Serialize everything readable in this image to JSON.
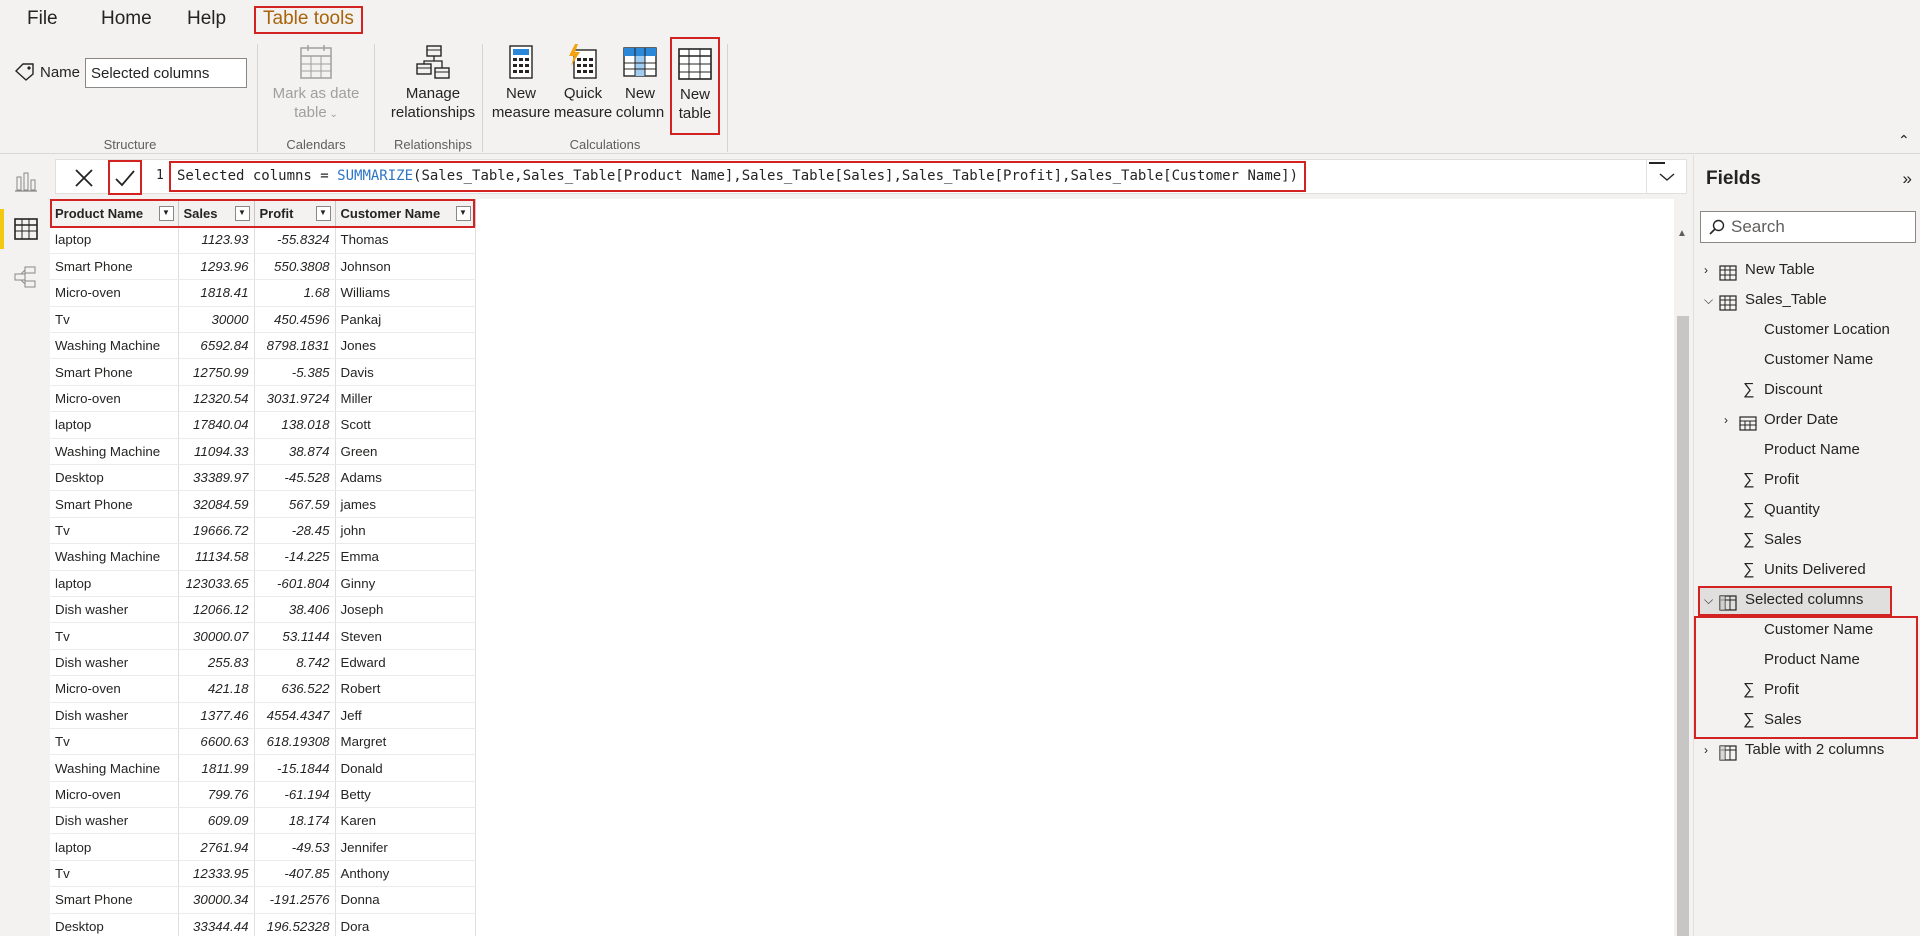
{
  "menu": {
    "items": [
      "File",
      "Home",
      "Help",
      "Table tools"
    ],
    "active": "Table tools"
  },
  "ribbon": {
    "structure": {
      "name_label": "Name",
      "name_value": "Selected columns",
      "group_label": "Structure"
    },
    "calendars": {
      "button": "Mark as date table",
      "line1": "Mark as date",
      "line2": "table",
      "group_label": "Calendars"
    },
    "relationships": {
      "line1": "Manage",
      "line2": "relationships",
      "group_label": "Relationships"
    },
    "calculations": {
      "group_label": "Calculations",
      "new_measure": {
        "line1": "New",
        "line2": "measure"
      },
      "quick_measure": {
        "line1": "Quick",
        "line2": "measure"
      },
      "new_column": {
        "line1": "New",
        "line2": "column"
      },
      "new_table": {
        "line1": "New",
        "line2": "table"
      }
    }
  },
  "formula_bar": {
    "line_number": "1",
    "prefix": "Selected columns = ",
    "function": "SUMMARIZE",
    "args": "(Sales_Table,Sales_Table[Product Name],Sales_Table[Sales],Sales_Table[Profit],Sales_Table[Customer Name])"
  },
  "table": {
    "columns": [
      "Product Name",
      "Sales",
      "Profit",
      "Customer Name"
    ],
    "rows": [
      [
        "laptop",
        "1123.93",
        "-55.8324",
        "Thomas"
      ],
      [
        "Smart Phone",
        "1293.96",
        "550.3808",
        "Johnson"
      ],
      [
        "Micro-oven",
        "1818.41",
        "1.68",
        "Williams"
      ],
      [
        "Tv",
        "30000",
        "450.4596",
        "Pankaj"
      ],
      [
        "Washing Machine",
        "6592.84",
        "8798.1831",
        "Jones"
      ],
      [
        "Smart Phone",
        "12750.99",
        "-5.385",
        "Davis"
      ],
      [
        "Micro-oven",
        "12320.54",
        "3031.9724",
        "Miller"
      ],
      [
        "laptop",
        "17840.04",
        "138.018",
        "Scott"
      ],
      [
        "Washing Machine",
        "11094.33",
        "38.874",
        "Green"
      ],
      [
        "Desktop",
        "33389.97",
        "-45.528",
        "Adams"
      ],
      [
        "Smart Phone",
        "32084.59",
        "567.59",
        "james"
      ],
      [
        "Tv",
        "19666.72",
        "-28.45",
        "john"
      ],
      [
        "Washing Machine",
        "11134.58",
        "-14.225",
        "Emma"
      ],
      [
        "laptop",
        "123033.65",
        "-601.804",
        "Ginny"
      ],
      [
        "Dish washer",
        "12066.12",
        "38.406",
        "Joseph"
      ],
      [
        "Tv",
        "30000.07",
        "53.1144",
        "Steven"
      ],
      [
        "Dish washer",
        "255.83",
        "8.742",
        "Edward"
      ],
      [
        "Micro-oven",
        "421.18",
        "636.522",
        "Robert"
      ],
      [
        "Dish washer",
        "1377.46",
        "4554.4347",
        "Jeff"
      ],
      [
        "Tv",
        "6600.63",
        "618.19308",
        "Margret"
      ],
      [
        "Washing Machine",
        "1811.99",
        "-15.1844",
        "Donald"
      ],
      [
        "Micro-oven",
        "799.76",
        "-61.194",
        "Betty"
      ],
      [
        "Dish washer",
        "609.09",
        "18.174",
        "Karen"
      ],
      [
        "laptop",
        "2761.94",
        "-49.53",
        "Jennifer"
      ],
      [
        "Tv",
        "12333.95",
        "-407.85",
        "Anthony"
      ],
      [
        "Smart Phone",
        "30000.34",
        "-191.2576",
        "Donna"
      ],
      [
        "Desktop",
        "33344.44",
        "196.52328",
        "Dora"
      ]
    ]
  },
  "fields_pane": {
    "title": "Fields",
    "search_placeholder": "Search",
    "tables": [
      {
        "name": "New Table",
        "expanded": false,
        "fields": []
      },
      {
        "name": "Sales_Table",
        "expanded": true,
        "fields": [
          {
            "name": "Customer Location",
            "type": "text"
          },
          {
            "name": "Customer Name",
            "type": "text"
          },
          {
            "name": "Discount",
            "type": "sum"
          },
          {
            "name": "Order Date",
            "type": "date"
          },
          {
            "name": "Product Name",
            "type": "text"
          },
          {
            "name": "Profit",
            "type": "sum"
          },
          {
            "name": "Quantity",
            "type": "sum"
          },
          {
            "name": "Sales",
            "type": "sum"
          },
          {
            "name": "Units Delivered",
            "type": "sum"
          }
        ]
      },
      {
        "name": "Selected columns",
        "expanded": true,
        "selected": true,
        "fields": [
          {
            "name": "Customer Name",
            "type": "text"
          },
          {
            "name": "Product Name",
            "type": "text"
          },
          {
            "name": "Profit",
            "type": "sum"
          },
          {
            "name": "Sales",
            "type": "sum"
          }
        ]
      },
      {
        "name": "Table with 2 columns",
        "expanded": false,
        "fields": []
      }
    ]
  },
  "colors": {
    "highlight_red": "#d32222",
    "accent_yellow": "#f2c811",
    "function_blue": "#2e75c4"
  }
}
